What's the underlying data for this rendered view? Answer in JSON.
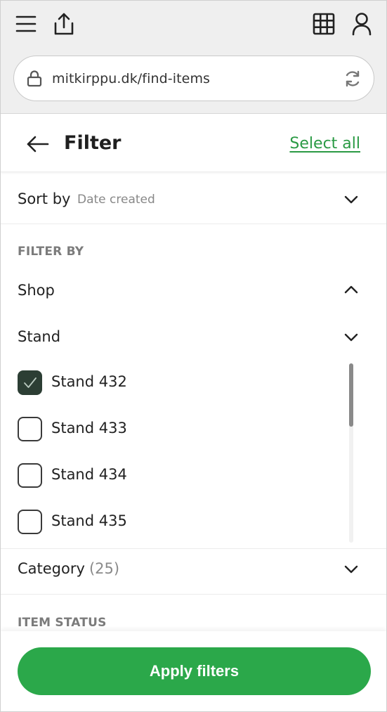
{
  "browser": {
    "url": "mitkirppu.dk/find-items",
    "icons": [
      "menu-icon",
      "share-icon",
      "grid-icon",
      "user-icon",
      "lock-icon",
      "reload-icon"
    ]
  },
  "header": {
    "title": "Filter",
    "select_all": "Select all"
  },
  "sort": {
    "label": "Sort by",
    "value": "Date created"
  },
  "filter_by": {
    "title": "FILTER BY",
    "shop": {
      "label": "Shop",
      "expanded": true
    },
    "stand": {
      "label": "Stand",
      "items": [
        {
          "label": "Stand 432",
          "checked": true
        },
        {
          "label": "Stand 433",
          "checked": false
        },
        {
          "label": "Stand 434",
          "checked": false
        },
        {
          "label": "Stand 435",
          "checked": false
        }
      ]
    },
    "category": {
      "label": "Category",
      "count": "(25)"
    }
  },
  "item_status": {
    "title": "ITEM STATUS"
  },
  "footer": {
    "apply_label": "Apply filters"
  },
  "colors": {
    "accent": "#2ba84a",
    "checkbox_checked": "#2c3e34",
    "link": "#2a9a44"
  }
}
